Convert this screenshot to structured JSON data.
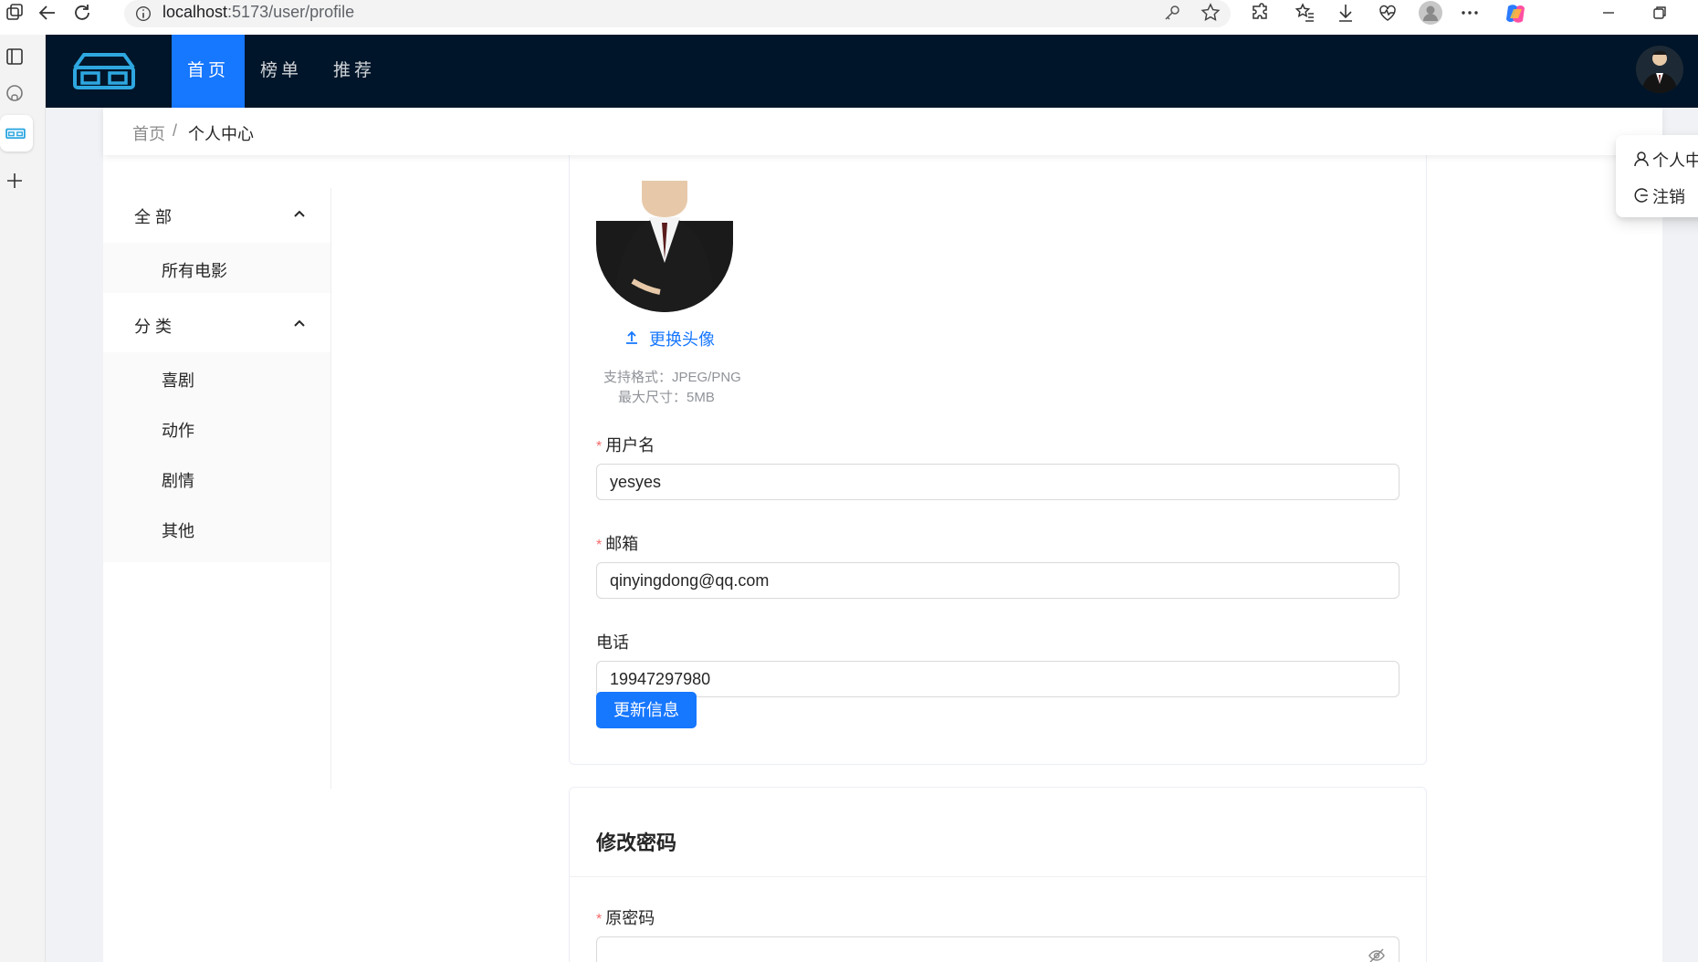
{
  "browser": {
    "url_host": "localhost",
    "url_path": ":5173/user/profile"
  },
  "nav": {
    "items": [
      {
        "label": "首页",
        "active": true
      },
      {
        "label": "榜单",
        "active": false
      },
      {
        "label": "推荐",
        "active": false
      }
    ]
  },
  "breadcrumb": {
    "home": "首页",
    "separator": "/",
    "current": "个人中心"
  },
  "sidebar": {
    "groups": [
      {
        "title": "全部",
        "items": [
          "所有电影"
        ]
      },
      {
        "title": "分类",
        "items": [
          "喜剧",
          "动作",
          "剧情",
          "其他"
        ]
      }
    ]
  },
  "profile": {
    "upload_label": "更换头像",
    "hint_format": "支持格式：JPEG/PNG",
    "hint_size": "最大尺寸：5MB",
    "username_label": "用户名",
    "username_value": "yesyes",
    "email_label": "邮箱",
    "email_value": "qinyingdong@qq.com",
    "phone_label": "电话",
    "phone_value": "19947297980",
    "submit_label": "更新信息"
  },
  "password": {
    "title": "修改密码",
    "old_label": "原密码"
  },
  "user_menu": {
    "profile": "个人中心",
    "logout": "注销"
  },
  "colors": {
    "primary": "#1677ff",
    "nav_bg": "#001529",
    "required": "#f56c6c"
  }
}
